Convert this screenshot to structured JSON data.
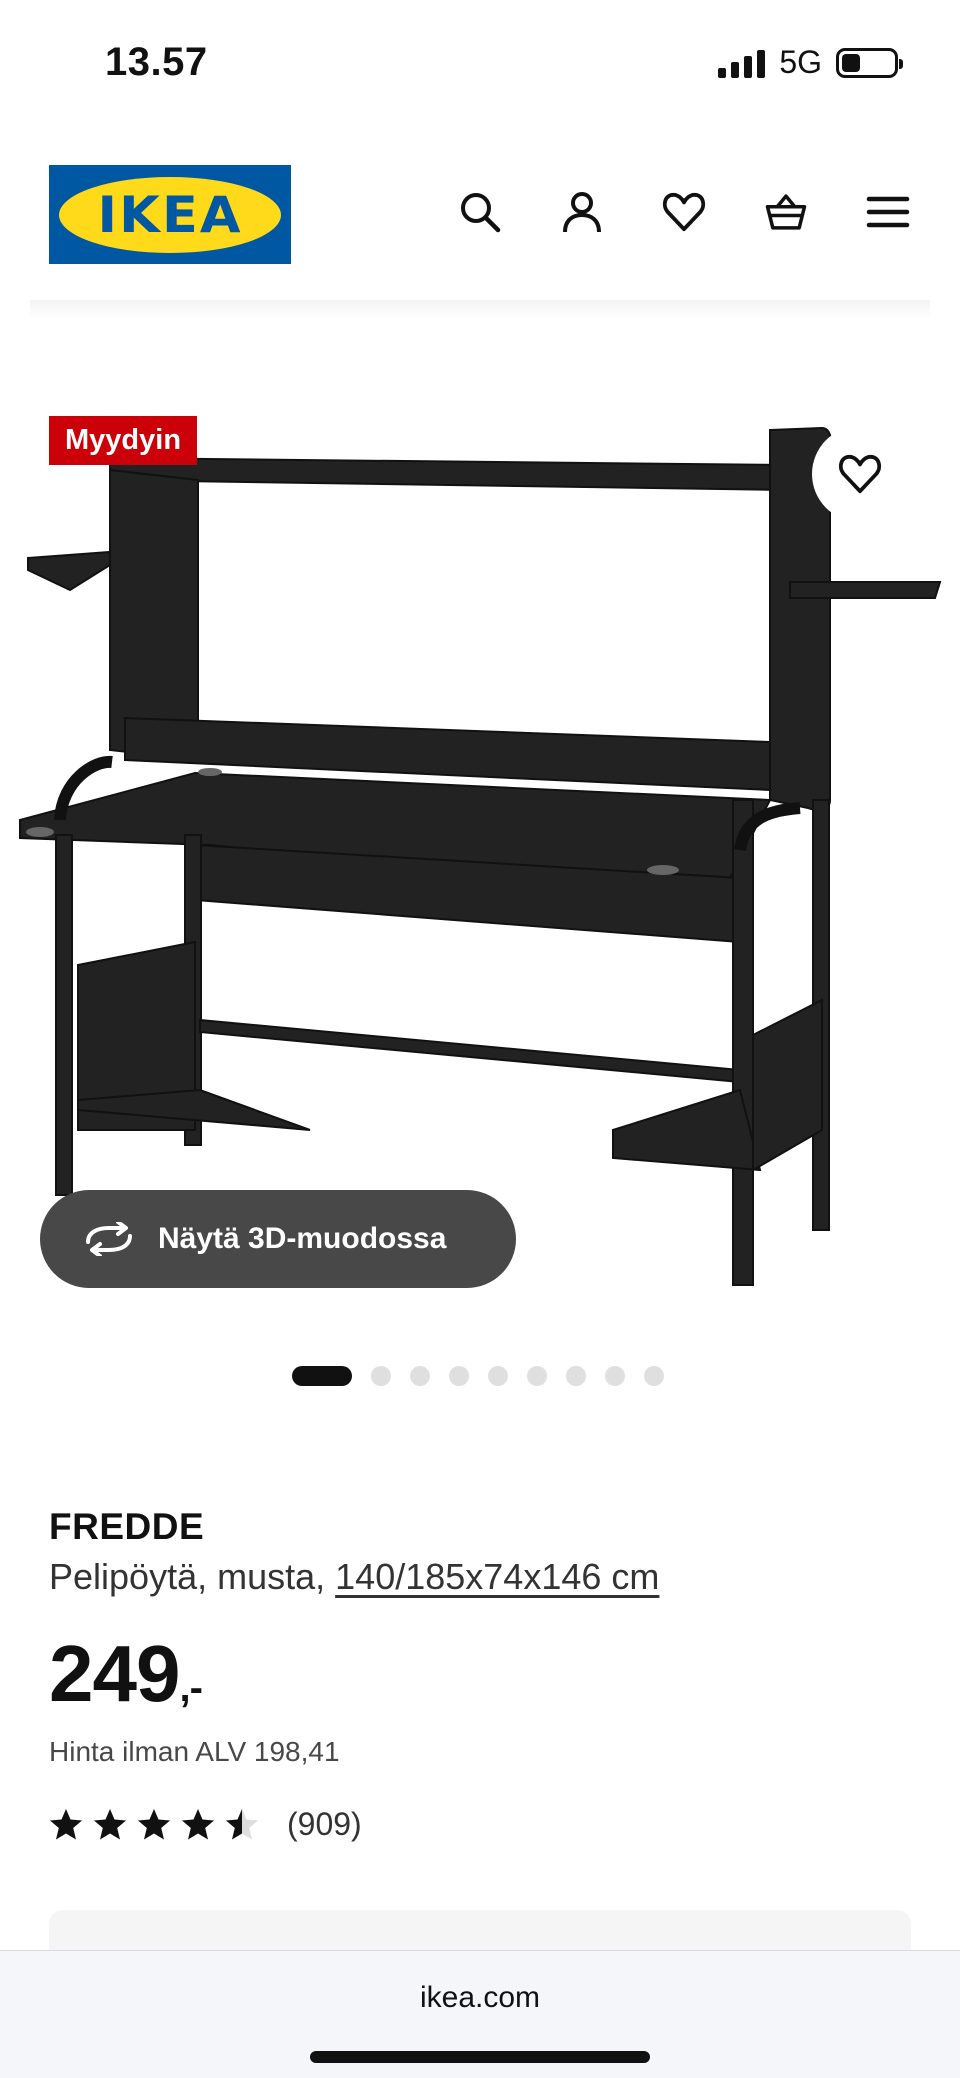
{
  "status_bar": {
    "time": "13.57",
    "network": "5G",
    "battery_level": 0.35
  },
  "header": {
    "logo_text": "IKEA",
    "icons": [
      "search-icon",
      "account-icon",
      "heart-icon",
      "basket-icon",
      "menu-icon"
    ]
  },
  "product_image": {
    "badge": "Myydyin",
    "view_3d_label": "Näytä 3D-muodossa",
    "carousel": {
      "total": 9,
      "active_index": 0
    }
  },
  "product": {
    "name": "FREDDE",
    "description": "Pelipöytä, musta,",
    "dimensions": "140/185x74x146 cm",
    "price": "249",
    "price_suffix": ",-",
    "price_ex_vat": "Hinta ilman ALV 198,41",
    "rating": 4.5,
    "rating_max": 5,
    "review_count": "(909)"
  },
  "browser": {
    "url": "ikea.com"
  },
  "colors": {
    "badge_red": "#cc0008",
    "ikea_blue": "#0058a3",
    "ikea_yellow": "#ffda1a",
    "button_dark": "#484848"
  }
}
